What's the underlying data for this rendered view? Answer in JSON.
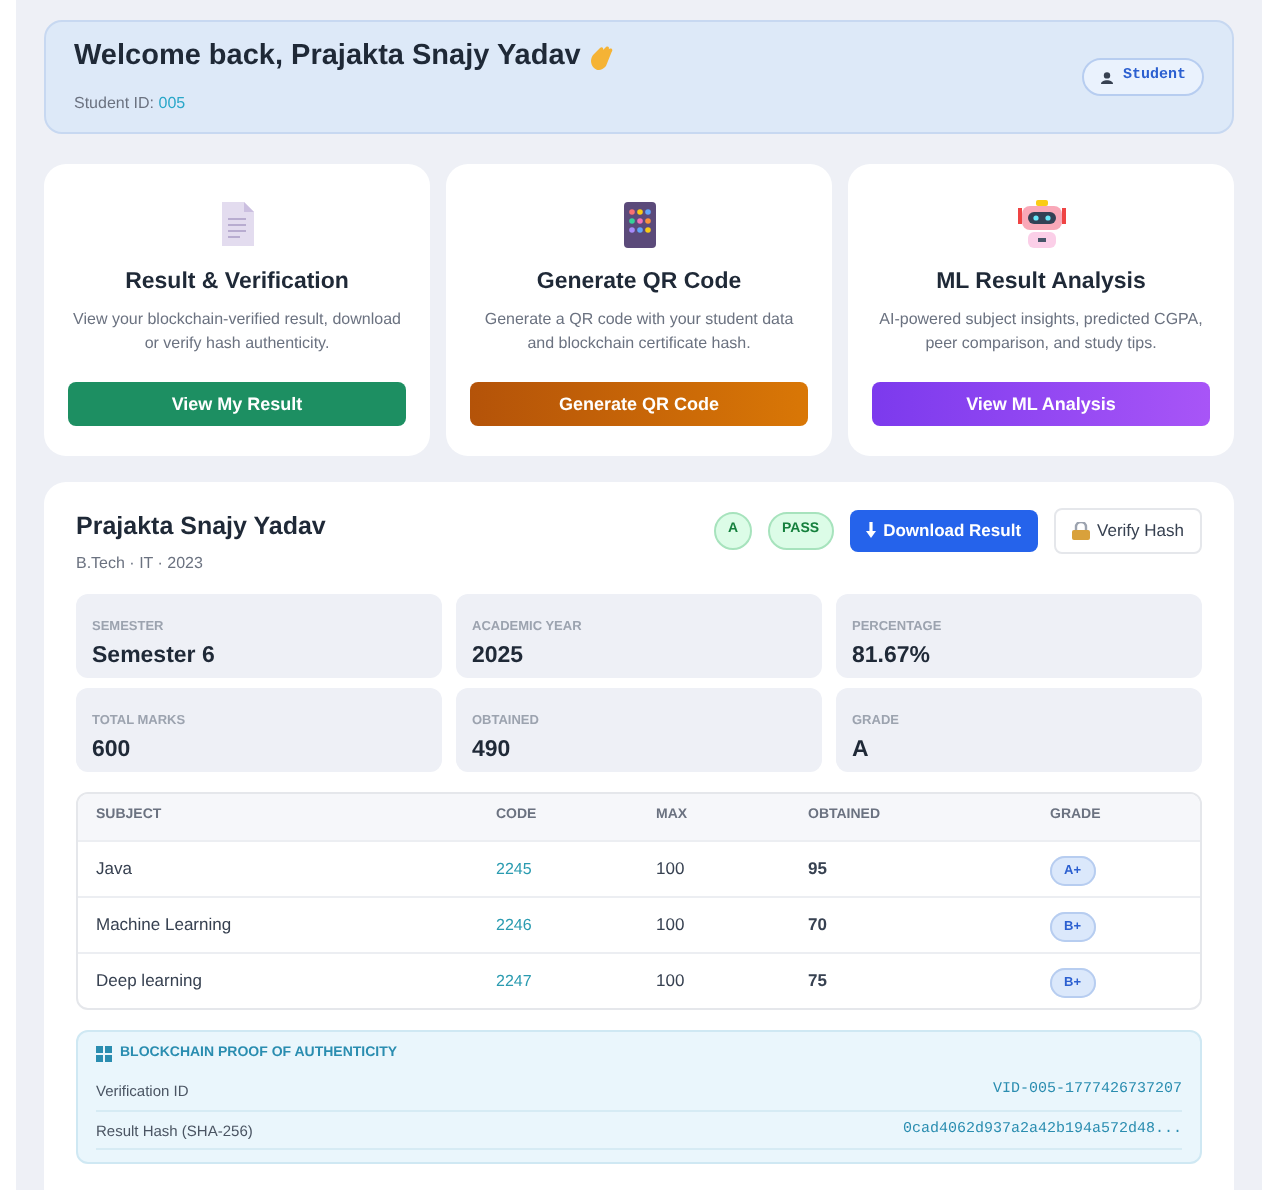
{
  "welcome": {
    "title": "Welcome back, Prajakta Snajy Yadav",
    "student_id_label": "Student ID:",
    "student_id": "005",
    "role_badge": "Student"
  },
  "features": [
    {
      "kind": "result",
      "title": "Result & Verification",
      "description": "View your blockchain-verified result, download or verify hash authenticity.",
      "button": "View My Result"
    },
    {
      "kind": "qr",
      "title": "Generate QR Code",
      "description": "Generate a QR code with your student data and blockchain certificate hash.",
      "button": "Generate QR Code"
    },
    {
      "kind": "ml",
      "title": "ML Result Analysis",
      "description": "AI-powered subject insights, predicted CGPA, peer comparison, and study tips.",
      "button": "View ML Analysis"
    }
  ],
  "result": {
    "name": "Prajakta Snajy Yadav",
    "subtitle": "B.Tech · IT · 2023",
    "grade_badge": "A",
    "status_badge": "PASS",
    "buttons": [
      {
        "kind": "download",
        "label": "Download Result"
      },
      {
        "kind": "verify",
        "label": "Verify Hash"
      }
    ],
    "stats": [
      {
        "label": "SEMESTER",
        "value": "Semester 6"
      },
      {
        "label": "ACADEMIC YEAR",
        "value": "2025"
      },
      {
        "label": "PERCENTAGE",
        "value": "81.67%"
      },
      {
        "label": "TOTAL MARKS",
        "value": "600"
      },
      {
        "label": "OBTAINED",
        "value": "490"
      },
      {
        "label": "GRADE",
        "value": "A"
      }
    ],
    "table": {
      "columns": [
        "SUBJECT",
        "CODE",
        "MAX",
        "OBTAINED",
        "GRADE"
      ],
      "rows": [
        {
          "subject": "Java",
          "code": "2245",
          "max": "100",
          "obtained": "95",
          "grade": "A+"
        },
        {
          "subject": "Machine Learning",
          "code": "2246",
          "max": "100",
          "obtained": "70",
          "grade": "B+"
        },
        {
          "subject": "Deep learning",
          "code": "2247",
          "max": "100",
          "obtained": "75",
          "grade": "B+"
        }
      ]
    },
    "proof": {
      "title": "BLOCKCHAIN PROOF OF AUTHENTICITY",
      "rows": [
        {
          "label": "Verification ID",
          "value": "VID-005-1777426737207"
        },
        {
          "label": "Result Hash (SHA-256)",
          "value": "0cad4062d937a2a42b194a572d48..."
        }
      ]
    }
  }
}
